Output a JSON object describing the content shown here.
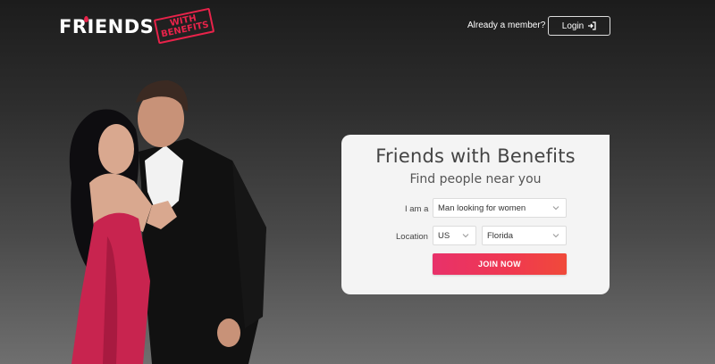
{
  "header": {
    "logo_word": "FRIENDS",
    "logo_stamp_top": "WITH",
    "logo_stamp_bottom": "BENEFITS",
    "already_member": "Already a member?",
    "login_label": "Login"
  },
  "form": {
    "title": "Friends with Benefits",
    "subtitle": "Find people near you",
    "i_am_label": "I am a",
    "i_am_value": "Man looking for women",
    "location_label": "Location",
    "country_value": "US",
    "state_value": "Florida",
    "join_label": "JOIN NOW"
  },
  "colors": {
    "accent": "#e8234a",
    "button_start": "#e8316a",
    "button_end": "#f04a3a",
    "panel_bg": "#f4f4f4"
  },
  "icons": {
    "login": "login-arrow-icon",
    "chevron": "chevron-down-icon"
  }
}
